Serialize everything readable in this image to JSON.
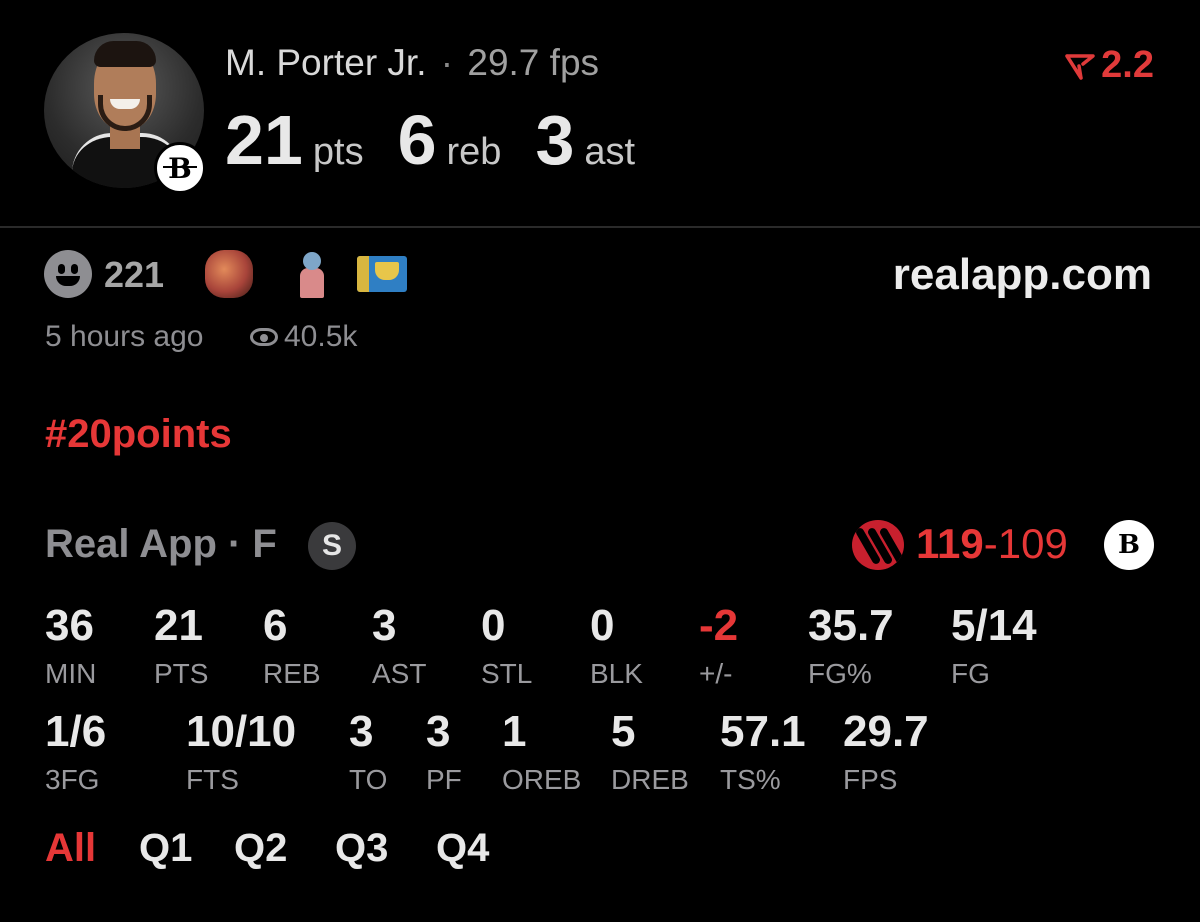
{
  "player": {
    "name": "M. Porter Jr.",
    "separator": "·",
    "fps": "29.7 fps",
    "team_icon": "nets-logo"
  },
  "statline": [
    {
      "value": "21",
      "unit": "pts"
    },
    {
      "value": "6",
      "unit": "reb"
    },
    {
      "value": "3",
      "unit": "ast"
    }
  ],
  "rating": {
    "value": "2.2",
    "color": "#e03a3a"
  },
  "reactions": {
    "count": "221",
    "icons": [
      "smiley-face-icon",
      "fire-emoji",
      "person-emoji",
      "flag-emoji"
    ]
  },
  "site": "realapp.com",
  "meta": {
    "time_ago": "5 hours ago",
    "views": "40.5k"
  },
  "hashtag": "#20points",
  "game": {
    "label": "Real App · F",
    "badge": "S",
    "score_home": "119",
    "score_sep": "-",
    "score_away": "109"
  },
  "stats_row1": [
    {
      "value": "36",
      "label": "MIN"
    },
    {
      "value": "21",
      "label": "PTS"
    },
    {
      "value": "6",
      "label": "REB"
    },
    {
      "value": "3",
      "label": "AST"
    },
    {
      "value": "0",
      "label": "STL"
    },
    {
      "value": "0",
      "label": "BLK"
    },
    {
      "value": "-2",
      "label": "+/-"
    },
    {
      "value": "35.7",
      "label": "FG%"
    },
    {
      "value": "5/14",
      "label": "FG"
    }
  ],
  "stats_row2": [
    {
      "value": "1/6",
      "label": "3FG"
    },
    {
      "value": "10/10",
      "label": "FTS"
    },
    {
      "value": "3",
      "label": "TO"
    },
    {
      "value": "3",
      "label": "PF"
    },
    {
      "value": "1",
      "label": "OREB"
    },
    {
      "value": "5",
      "label": "DREB"
    },
    {
      "value": "57.1",
      "label": "TS%"
    },
    {
      "value": "29.7",
      "label": "FPS"
    }
  ],
  "quarters": [
    "All",
    "Q1",
    "Q2",
    "Q3",
    "Q4"
  ],
  "colors": {
    "accent": "#e63737",
    "muted": "#8e8e92",
    "background": "#000000"
  }
}
